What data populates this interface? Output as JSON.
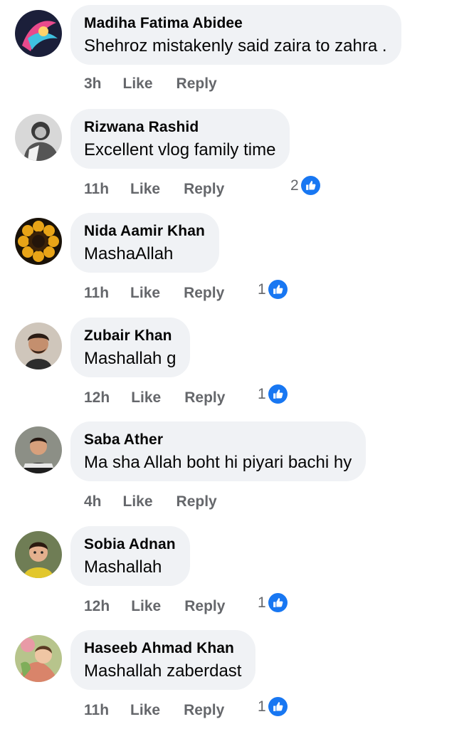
{
  "actions": {
    "like": "Like",
    "reply": "Reply"
  },
  "colors": {
    "bubble": "#f0f2f5",
    "meta": "#65676b",
    "like_badge": "#1877f2"
  },
  "comments": [
    {
      "author": "Madiha Fatima Abidee",
      "text": "Shehroz mistakenly said zaira to zahra .",
      "time": "3h",
      "reaction_count": ""
    },
    {
      "author": "Rizwana Rashid",
      "text": "Excellent vlog  family time",
      "time": "11h",
      "reaction_count": "2"
    },
    {
      "author": "Nida Aamir Khan",
      "text": "MashaAllah",
      "time": "11h",
      "reaction_count": "1"
    },
    {
      "author": "Zubair Khan",
      "text": "Mashallah g",
      "time": "12h",
      "reaction_count": "1"
    },
    {
      "author": "Saba Ather",
      "text": "Ma sha Allah boht hi piyari bachi hy",
      "time": "4h",
      "reaction_count": ""
    },
    {
      "author": "Sobia Adnan",
      "text": "Mashallah",
      "time": "12h",
      "reaction_count": "1"
    },
    {
      "author": "Haseeb Ahmad Khan",
      "text": "Mashallah zaberdast",
      "time": "11h",
      "reaction_count": "1"
    }
  ]
}
